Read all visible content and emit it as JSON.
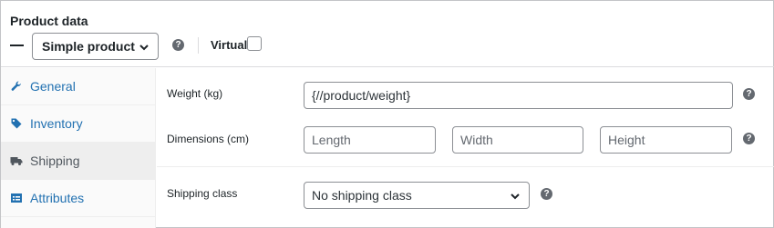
{
  "panel": {
    "title": "Product data"
  },
  "product_type": {
    "selected": "Simple product",
    "icon": "chevron-down-icon"
  },
  "virtual": {
    "label": "Virtual",
    "checked": false
  },
  "sidebar": {
    "items": [
      {
        "label": "General",
        "icon": "wrench-icon",
        "active": false
      },
      {
        "label": "Inventory",
        "icon": "tag-icon",
        "active": false
      },
      {
        "label": "Shipping",
        "icon": "truck-icon",
        "active": true
      },
      {
        "label": "Attributes",
        "icon": "table-icon",
        "active": false
      }
    ]
  },
  "shipping": {
    "weight": {
      "label": "Weight (kg)",
      "value": "{//product/weight}"
    },
    "dimensions": {
      "label": "Dimensions (cm)",
      "length_placeholder": "Length",
      "width_placeholder": "Width",
      "height_placeholder": "Height"
    },
    "shipping_class": {
      "label": "Shipping class",
      "selected": "No shipping class"
    }
  },
  "help_glyph": "?",
  "colors": {
    "link": "#2271b1",
    "help": "#646970",
    "border": "#8c8f94",
    "active_tab_bg": "#eeeeee"
  }
}
